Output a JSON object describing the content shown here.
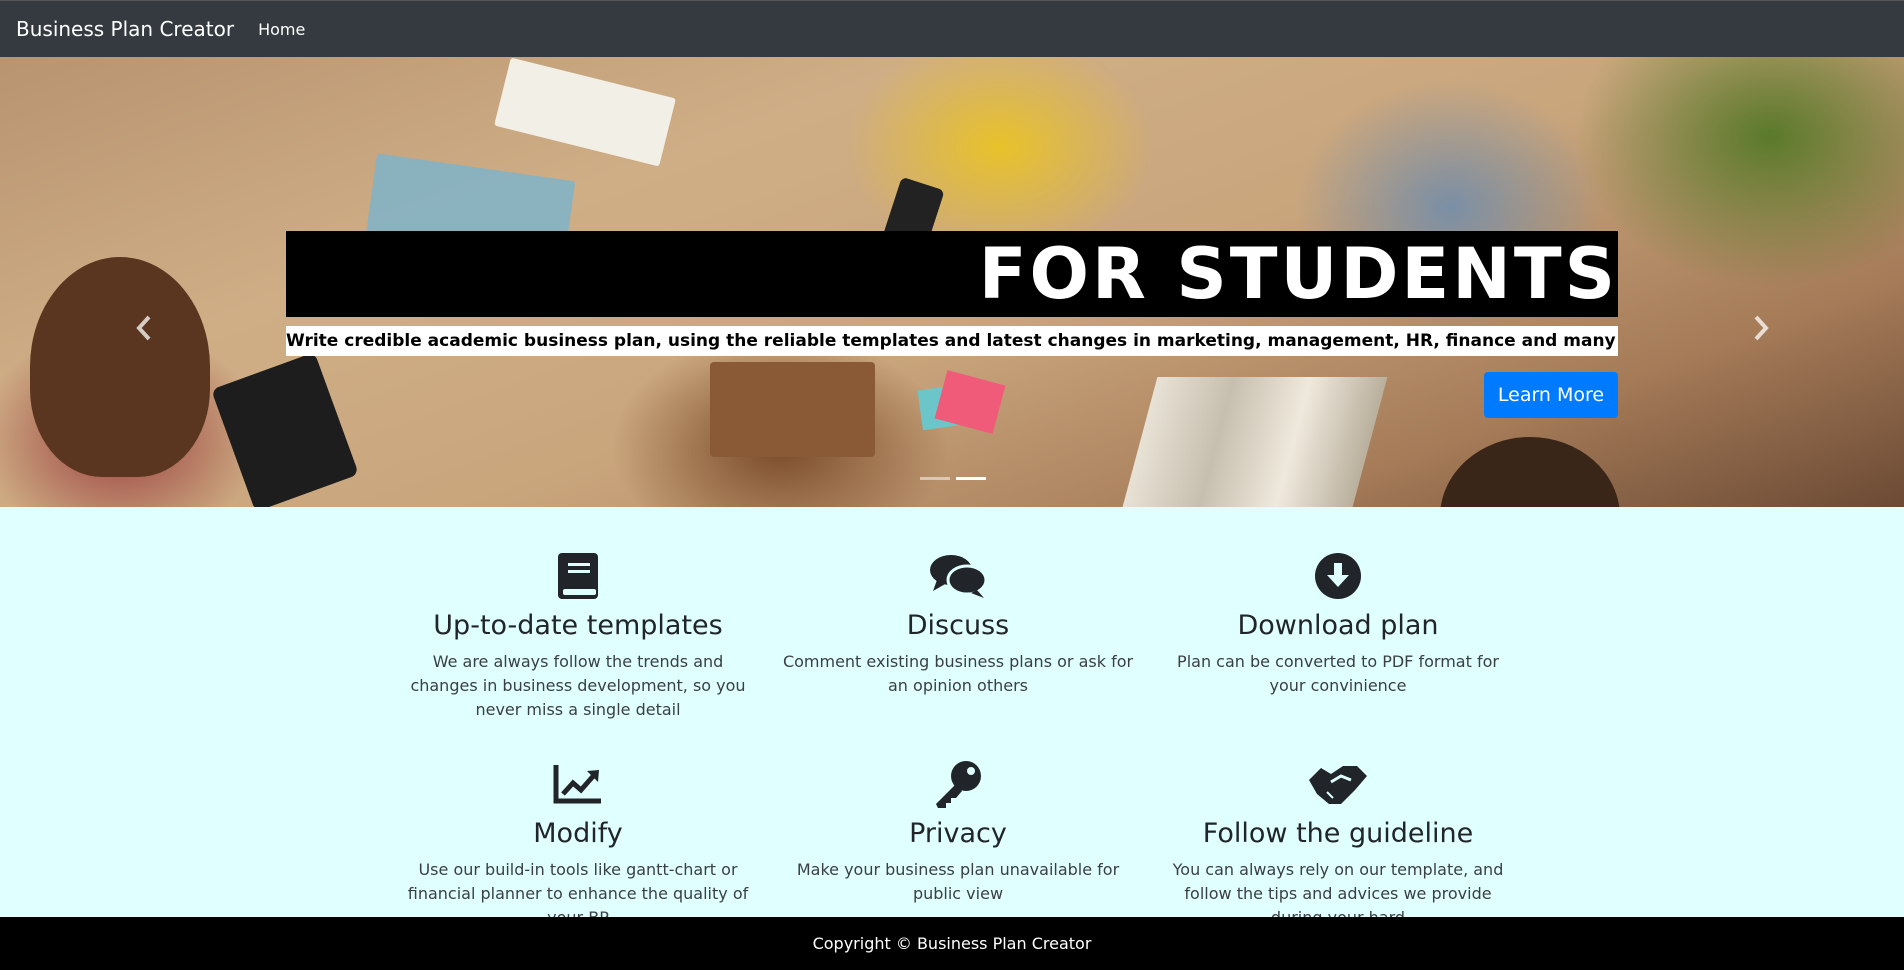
{
  "navbar": {
    "brand": "Business Plan Creator",
    "home": "Home"
  },
  "hero": {
    "title": "FOR STUDENTS",
    "subtitle": "Write credible academic business plan, using the reliable templates and latest changes in marketing, management, HR, finance and many other fields",
    "button": "Learn More",
    "prev_icon": "chevron-left-icon",
    "next_icon": "chevron-right-icon",
    "slides_count": 2,
    "active_slide": 2
  },
  "features": [
    {
      "icon": "book-icon",
      "title": "Up-to-date templates",
      "text": "We are always follow the trends and changes in business development, so you never miss a single detail"
    },
    {
      "icon": "comments-icon",
      "title": "Discuss",
      "text": "Comment existing business plans or ask for an opinion others"
    },
    {
      "icon": "download-circle-icon",
      "title": "Download plan",
      "text": "Plan can be converted to PDF format for your convinience"
    },
    {
      "icon": "chart-line-icon",
      "title": "Modify",
      "text": "Use our build-in tools like gantt-chart or financial planner to enhance the quality of your BP"
    },
    {
      "icon": "key-icon",
      "title": "Privacy",
      "text": "Make your business plan unavailable for public view"
    },
    {
      "icon": "handshake-icon",
      "title": "Follow the guideline",
      "text": "You can always rely on our template, and follow the tips and advices we provide during your hard"
    }
  ],
  "colors": {
    "navbar": "#343a40",
    "accent": "#007bff",
    "section_bg": "#e0ffff",
    "footer": "#000000"
  },
  "footer": {
    "text": "Copyright © Business Plan Creator"
  }
}
